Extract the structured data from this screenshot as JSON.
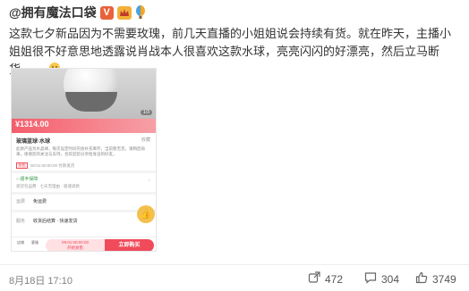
{
  "post": {
    "author": "@拥有魔法口袋",
    "verify_glyph": "V",
    "badge_glyph": "V",
    "text_parts": [
      "这款七夕新品因为不需要玫瑰，前几天直播的小姐姐说会持续有货。就在昨天，主播小姐姐很不好意思地透露说肖战本人很喜欢这款水球，亮亮闪闪的好漂亮，然后立马断货……"
    ],
    "emoji": "bow-face-emoji"
  },
  "screenshot": {
    "page_indicator": "1/3",
    "price": "¥1314.00",
    "title": "玻璃蓝球·水球",
    "fav": "收藏",
    "desc": "此款产品为水晶球，每次设定时间内会补充库存，当前暂无货，请稍后再来，谢谢您的关注与支持，也欢迎您分享给身边的好友。",
    "tag": "预售",
    "tag_text": "00:01:00:00:00  付款发货",
    "deliver": "○ 顺丰保障",
    "deliver_sub": "退货包运费 · 七天无理由 · 极速退款",
    "rows": [
      {
        "label": "运费",
        "value": "免运费"
      },
      {
        "label": "服务",
        "value": "收货后结算 · 快速发货"
      }
    ],
    "shop": "店铺",
    "cs": "客服",
    "countdown_top": "09:01:00:00:00",
    "countdown_bottom": "开始发售",
    "buy": "立即购买",
    "sticker": "👍"
  },
  "footer": {
    "date": "8月18日 17:10",
    "share_count": "472",
    "comment_count": "304",
    "like_count": "3749"
  },
  "colors": {
    "accent": "#f04b5a",
    "verify": "#e8623c"
  }
}
